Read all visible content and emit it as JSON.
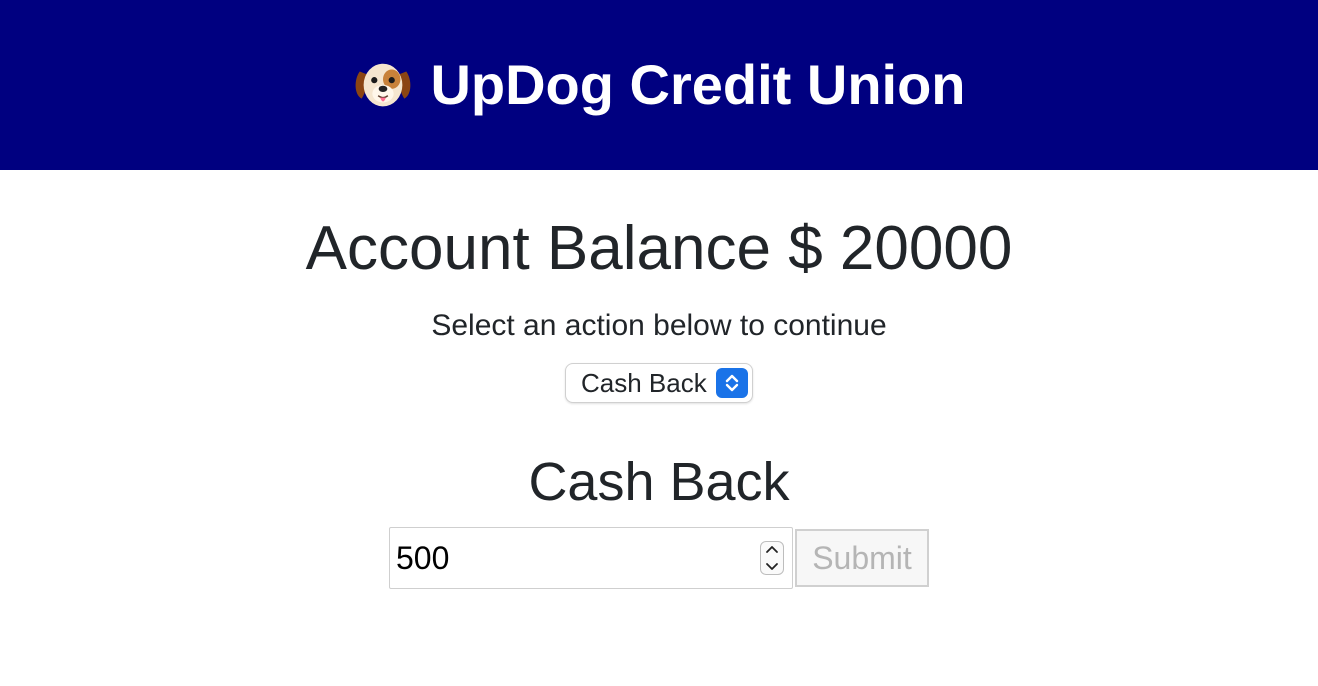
{
  "header": {
    "title": "UpDog Credit Union",
    "logo_icon": "dog-face-icon",
    "background_color": "#000080"
  },
  "account": {
    "balance_text": "Account Balance $ 20000"
  },
  "instruction": "Select an action below to continue",
  "action_select": {
    "selected": "Cash Back",
    "accent_color": "#1a73e8"
  },
  "section": {
    "title": "Cash Back"
  },
  "form": {
    "amount_value": "500",
    "submit_label": "Submit",
    "submit_state": "disabled"
  }
}
